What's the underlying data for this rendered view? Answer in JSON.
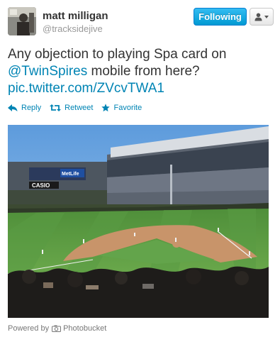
{
  "user": {
    "name": "matt milligan",
    "handle": "@tracksidejive"
  },
  "buttons": {
    "following_label": "Following",
    "user_menu_icon": "person-dropdown-icon"
  },
  "tweet": {
    "line1": "Any objection to playing Spa card on",
    "mention": "@TwinSpires",
    "line2_rest": " mobile from here?",
    "link": "pic.twitter.com/ZVcvTWA1"
  },
  "actions": {
    "reply": "Reply",
    "retweet": "Retweet",
    "favorite": "Favorite"
  },
  "photo": {
    "sign_text": "CASIO",
    "scoreboard_text": "MetLife"
  },
  "attribution": {
    "prefix": "Powered by",
    "service": "Photobucket"
  },
  "colors": {
    "link": "#0084b4",
    "follow_button": "#019ad2",
    "text": "#333333",
    "muted": "#999999"
  }
}
